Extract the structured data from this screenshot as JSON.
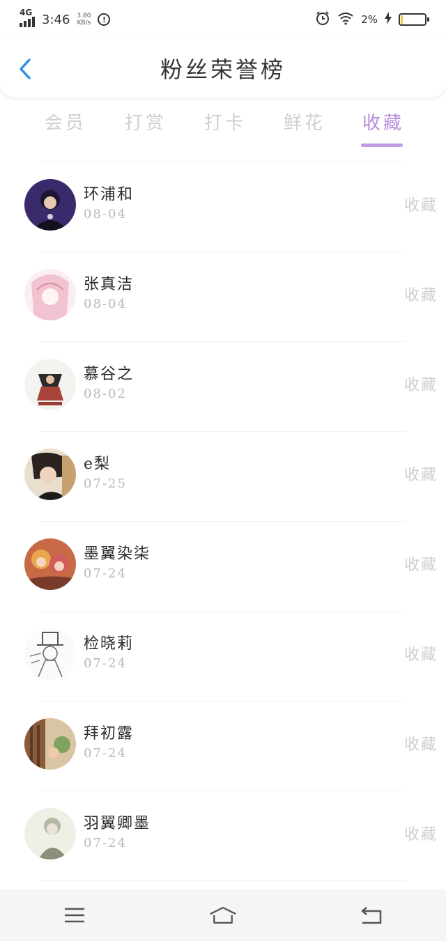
{
  "status_bar": {
    "network": "4G",
    "time": "3:46",
    "speed_value": "3.80",
    "speed_unit": "KB/s",
    "battery": "2%"
  },
  "header": {
    "title": "粉丝荣誉榜"
  },
  "tabs": [
    {
      "label": "会员"
    },
    {
      "label": "打赏"
    },
    {
      "label": "打卡"
    },
    {
      "label": "鲜花"
    },
    {
      "label": "收藏"
    }
  ],
  "active_tab": "收藏",
  "accent_color": "#b48ad9",
  "rows": [
    {
      "name": "环浦和",
      "date": "08-04",
      "action": "收藏",
      "avatar_color": "#3b2a6b"
    },
    {
      "name": "张真洁",
      "date": "08-04",
      "action": "收藏",
      "avatar_color": "#f3c9d3"
    },
    {
      "name": "慕谷之",
      "date": "08-02",
      "action": "收藏",
      "avatar_color": "#a8443a"
    },
    {
      "name": "e梨",
      "date": "07-25",
      "action": "收藏",
      "avatar_color": "#d9b9a0"
    },
    {
      "name": "墨翼染柒",
      "date": "07-24",
      "action": "收藏",
      "avatar_color": "#c76a45"
    },
    {
      "name": "检晓莉",
      "date": "07-24",
      "action": "收藏",
      "avatar_color": "#e6e6e6"
    },
    {
      "name": "拜初露",
      "date": "07-24",
      "action": "收藏",
      "avatar_color": "#b58b5d"
    },
    {
      "name": "羽翼卿墨",
      "date": "07-24",
      "action": "收藏",
      "avatar_color": "#d7dcc8"
    }
  ],
  "nav": {
    "menu_icon": "menu-icon",
    "home_icon": "home-icon",
    "back_icon": "return-icon"
  }
}
